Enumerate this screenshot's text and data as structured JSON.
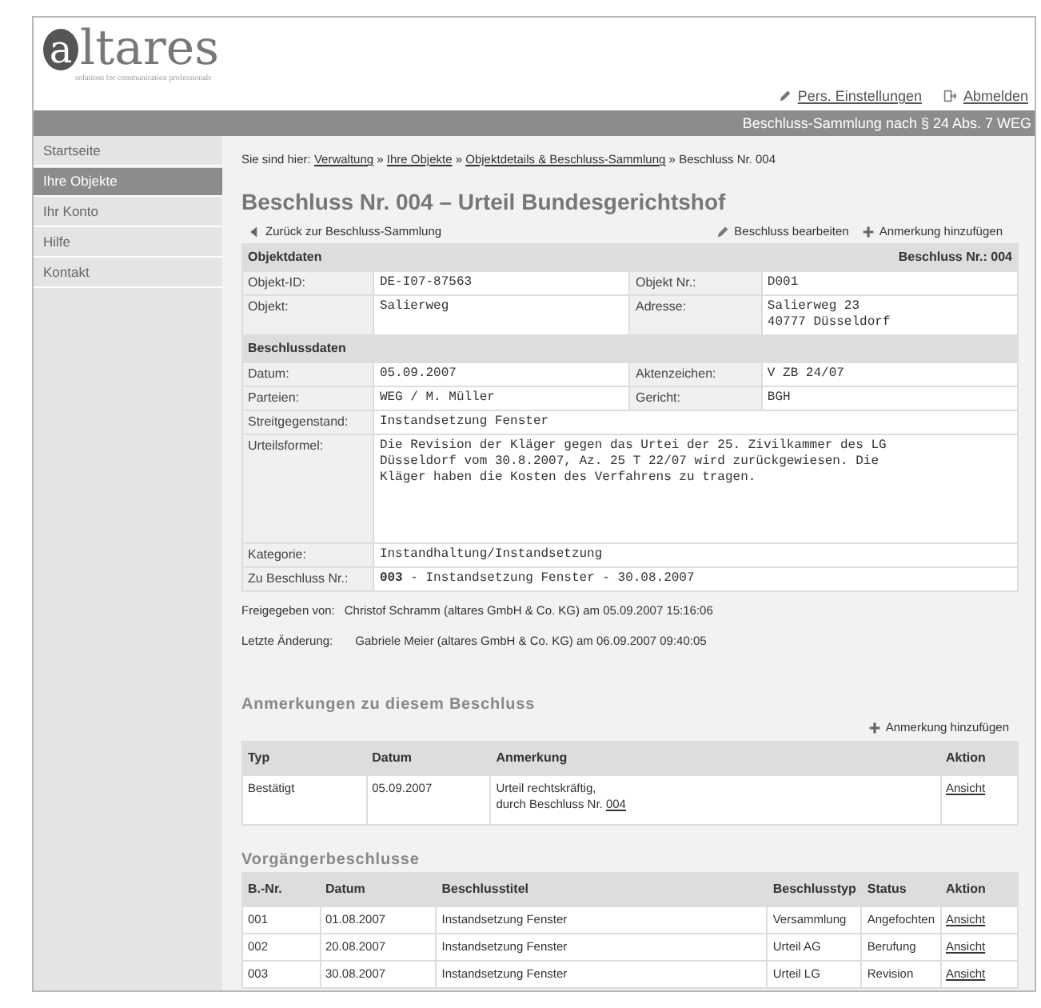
{
  "logo": {
    "name": "altares",
    "tagline": "solutions for communication professionals"
  },
  "header_links": [
    {
      "label": "Pers. Einstellungen"
    },
    {
      "label": "Abmelden"
    }
  ],
  "banner": "Beschluss-Sammlung nach § 24 Abs. 7 WEG",
  "sidebar": {
    "items": [
      {
        "label": "Startseite",
        "selected": false
      },
      {
        "label": "Ihre Objekte",
        "selected": true
      },
      {
        "label": "Ihr Konto",
        "selected": false
      },
      {
        "label": "Hilfe",
        "selected": false
      },
      {
        "label": "Kontakt",
        "selected": false
      }
    ]
  },
  "breadcrumb": {
    "prefix": "Sie sind hier:",
    "separator": "»",
    "links": [
      "Verwaltung",
      "Ihre Objekte",
      "Objektdetails & Beschluss-Sammlung"
    ],
    "current": "Beschluss Nr. 004"
  },
  "page_title": "Beschluss Nr. 004 – Urteil Bundesgerichtshof",
  "back_link": "Zurück zur Beschluss-Sammlung",
  "actions": [
    {
      "label": "Beschluss bearbeiten"
    },
    {
      "label": "Anmerkung hinzufügen"
    }
  ],
  "details": {
    "sections": [
      {
        "title": "Objektdaten",
        "aside": "Beschluss Nr.: 004",
        "rows": [
          {
            "kind": "pair",
            "fields": [
              {
                "label": "Objekt-ID:",
                "value": "DE-I07-87563"
              },
              {
                "label": "Objekt Nr.:",
                "value": "D001"
              }
            ]
          },
          {
            "kind": "pair",
            "fields": [
              {
                "label": "Objekt:",
                "value": "Salierweg"
              },
              {
                "label": "Adresse:",
                "value": "Salierweg 23\n40777 Düsseldorf"
              }
            ]
          }
        ]
      },
      {
        "title": "Beschlussdaten",
        "rows": [
          {
            "kind": "pair",
            "fields": [
              {
                "label": "Datum:",
                "value": "05.09.2007"
              },
              {
                "label": "Aktenzeichen:",
                "value": "V ZB 24/07"
              }
            ]
          },
          {
            "kind": "pair",
            "fields": [
              {
                "label": "Parteien:",
                "value": "WEG / M. Müller"
              },
              {
                "label": "Gericht:",
                "value": "BGH"
              }
            ]
          },
          {
            "kind": "wide",
            "fields": [
              {
                "label": "Streitgegenstand:",
                "value": "Instandsetzung Fenster"
              }
            ]
          },
          {
            "kind": "block",
            "fields": [
              {
                "label": "Urteilsformel:",
                "value": "Die Revision der Kläger gegen das Urtei der 25. Zivilkammer des LG\nDüsseldorf vom 30.8.2007, Az. 25 T 22/07 wird zurückgewiesen. Die\nKläger haben die Kosten des Verfahrens zu tragen."
              }
            ]
          },
          {
            "kind": "wide",
            "fields": [
              {
                "label": "Kategorie:",
                "value": "Instandhaltung/Instandsetzung"
              }
            ]
          },
          {
            "kind": "wide",
            "fields": [
              {
                "label": "Zu Beschluss Nr.:",
                "value": "**003** - Instandsetzung Fenster - 30.08.2007"
              }
            ]
          }
        ]
      }
    ]
  },
  "meta": [
    {
      "label": "Freigegeben von:",
      "value": "Christof Schramm (altares GmbH & Co. KG) am 05.09.2007 15:16:06"
    },
    {
      "label": "Letzte Änderung:",
      "value": "Gabriele Meier (altares GmbH & Co. KG) am 06.09.2007 09:40:05"
    }
  ],
  "notes": {
    "title": "Anmerkungen zu diesem Beschluss",
    "add_link": "Anmerkung hinzufügen",
    "columns": [
      "Typ",
      "Datum",
      "Anmerkung",
      "Aktion"
    ],
    "rows": [
      {
        "type": "Bestätigt",
        "date": "05.09.2007",
        "note": "Urteil rechtskräftig,\ndurch Beschluss Nr.",
        "note_link": "004",
        "action": "Ansicht"
      }
    ]
  },
  "predecessors": {
    "title": "Vorgängerbeschlusse",
    "columns": [
      "B.-Nr.",
      "Datum",
      "Beschlusstitel",
      "Beschlusstyp",
      "Status",
      "Aktion"
    ],
    "rows": [
      {
        "cells": [
          "001",
          "01.08.2007",
          "Instandsetzung Fenster",
          "Versammlung",
          "Angefochten"
        ],
        "action": "Ansicht"
      },
      {
        "cells": [
          "002",
          "20.08.2007",
          "Instandsetzung Fenster",
          "Urteil AG",
          "Berufung"
        ],
        "action": "Ansicht"
      },
      {
        "cells": [
          "003",
          "30.08.2007",
          "Instandsetzung Fenster",
          "Urteil LG",
          "Revision"
        ],
        "action": "Ansicht"
      }
    ]
  }
}
